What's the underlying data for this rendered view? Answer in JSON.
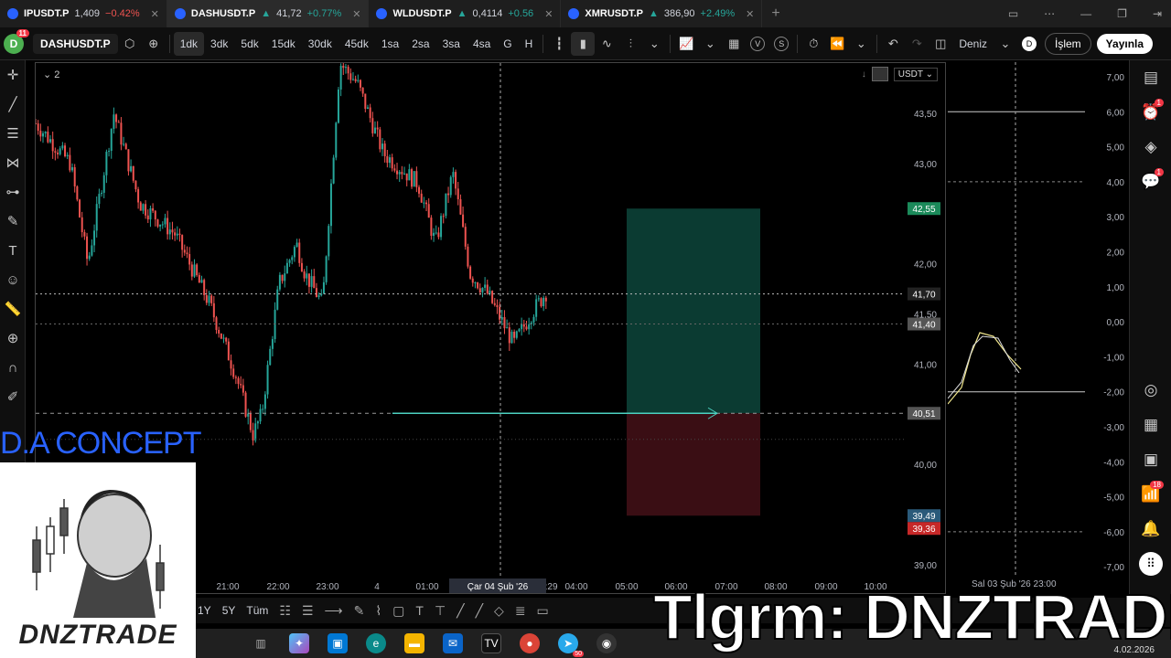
{
  "tabs": [
    {
      "symbol": "IPUSDT.P",
      "price": "1,409",
      "change": "−0.42%",
      "dir": "dn",
      "active": false
    },
    {
      "symbol": "DASHUSDT.P",
      "price": "41,72",
      "change": "+0.77%",
      "dir": "up",
      "active": true
    },
    {
      "symbol": "WLDUSDT.P",
      "price": "0,4114",
      "change": "+0.56",
      "dir": "up",
      "active": false
    },
    {
      "symbol": "XMRUSDT.P",
      "price": "386,90",
      "change": "+2.49%",
      "dir": "up",
      "active": false
    }
  ],
  "toolbar": {
    "avatar_letter": "D",
    "avatar_badge": "11",
    "symbol": "DASHUSDT.P",
    "intervals": [
      "1dk",
      "3dk",
      "5dk",
      "15dk",
      "30dk",
      "45dk",
      "1sa",
      "2sa",
      "3sa",
      "4sa",
      "G",
      "H"
    ],
    "active_interval": "1dk",
    "letter_v": "V",
    "letter_s": "S",
    "profile_name": "Deniz",
    "profile_letter": "D",
    "trade_label": "İşlem",
    "publish_label": "Yayınla"
  },
  "chart": {
    "pane_count": "2",
    "currency": "USDT",
    "price_ticks": [
      "43,50",
      "43,00",
      "42,00",
      "41,50",
      "41,00",
      "40,00",
      "39,00"
    ],
    "time_ticks": [
      "21:00",
      "22:00",
      "23:00",
      "4",
      "01:00",
      "02:29",
      "04:00",
      "05:00",
      "06:00",
      "07:00",
      "08:00",
      "09:00",
      "10:00"
    ],
    "crosshair_date": "Çar 04 Şub '26",
    "labels": {
      "target": "42,55",
      "current": "41,70",
      "level2": "41,40",
      "entry": "40,51",
      "stop1": "39,49",
      "stop2": "39,36"
    },
    "colors": {
      "up": "#26a69a",
      "down": "#ef5350",
      "target_zone": "#0b3b32",
      "stop_zone": "#3a0e14"
    }
  },
  "chart_data": {
    "type": "candlestick",
    "symbol": "DASHUSDT.P",
    "ylim": [
      38.7,
      44.0
    ],
    "close_path": [
      [
        0,
        43.4
      ],
      [
        0.04,
        43.0
      ],
      [
        0.06,
        42.0
      ],
      [
        0.09,
        43.5
      ],
      [
        0.12,
        42.6
      ],
      [
        0.16,
        42.3
      ],
      [
        0.2,
        41.6
      ],
      [
        0.23,
        40.9
      ],
      [
        0.25,
        40.3
      ],
      [
        0.26,
        40.5
      ],
      [
        0.28,
        41.8
      ],
      [
        0.3,
        42.2
      ],
      [
        0.31,
        41.9
      ],
      [
        0.33,
        41.6
      ],
      [
        0.35,
        44.0
      ],
      [
        0.37,
        43.8
      ],
      [
        0.4,
        43.1
      ],
      [
        0.44,
        42.8
      ],
      [
        0.46,
        42.2
      ],
      [
        0.48,
        42.9
      ],
      [
        0.5,
        41.9
      ],
      [
        0.52,
        41.7
      ],
      [
        0.55,
        41.2
      ],
      [
        0.57,
        41.5
      ],
      [
        0.59,
        41.75
      ]
    ]
  },
  "subpane": {
    "ticks": [
      "7,00",
      "6,00",
      "5,00",
      "4,00",
      "3,00",
      "2,00",
      "1,00",
      "0,00",
      "-1,00",
      "-2,00",
      "-3,00",
      "-4,00",
      "-5,00",
      "-6,00",
      "-7,00"
    ],
    "date_label": "Sal 03 Şub '26",
    "time_label": "23:00"
  },
  "bottom": {
    "ranges": [
      "1Y",
      "5Y",
      "Tüm"
    ]
  },
  "watermark": {
    "title": "D.A CONCEPT",
    "brand": "DNZTRADE",
    "telegram": "Tlgrm: DNZTRADE"
  },
  "taskbar": {
    "date": "4.02.2026",
    "badge": "50"
  }
}
